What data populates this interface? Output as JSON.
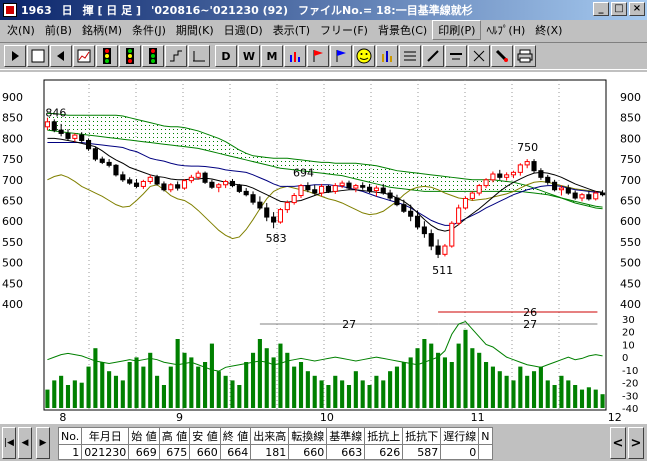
{
  "window": {
    "code": "1963",
    "period": "日",
    "name": "揮 [ 日 足 ]",
    "range": "'020816~'021230 (92)",
    "file": "ファイルNo.= 18:一目基準線就杉"
  },
  "menu": [
    {
      "label": "次(N)"
    },
    {
      "label": "前(B)"
    },
    {
      "label": "銘柄(M)"
    },
    {
      "label": "条件(J)"
    },
    {
      "label": "期間(K)"
    },
    {
      "label": "日週(D)"
    },
    {
      "label": "表示(T)"
    },
    {
      "label": "フリー(F)"
    },
    {
      "label": "背景色(C)"
    },
    {
      "label": "印刷(P)"
    },
    {
      "label": "ﾍﾙﾌﾟ(H)"
    },
    {
      "label": "終(X)"
    }
  ],
  "toolbar": {
    "d": "D",
    "w": "W",
    "m": "M"
  },
  "chart_data": {
    "type": "candlestick",
    "price_axis": {
      "min": 400,
      "max": 900,
      "ticks": [
        900,
        850,
        800,
        750,
        700,
        650,
        600,
        550,
        500,
        450,
        400
      ]
    },
    "osc_axis": {
      "ticks": [
        30,
        20,
        10,
        0,
        -10,
        -20,
        -30,
        -40
      ]
    },
    "month_labels": [
      {
        "label": "8",
        "i": 0
      },
      {
        "label": "9",
        "i": 17
      },
      {
        "label": "10",
        "i": 38
      },
      {
        "label": "11",
        "i": 60
      },
      {
        "label": "12",
        "i": 80
      }
    ],
    "annotations": {
      "high1": "846",
      "low1": "583",
      "mid1": "694",
      "high2": "750",
      "low2": "511",
      "span1": "27",
      "span2": "26",
      "span3": "27"
    },
    "colors": {
      "up": "#ff0000",
      "down": "#000000",
      "base": "#000080",
      "conv": "#000000",
      "lag": "#808000",
      "cloud": "#008000",
      "volume": "#008000",
      "osc": "#008000"
    },
    "ohlc": [
      [
        828,
        850,
        820,
        840
      ],
      [
        840,
        846,
        815,
        820
      ],
      [
        820,
        835,
        805,
        812
      ],
      [
        812,
        822,
        795,
        800
      ],
      [
        800,
        812,
        792,
        808
      ],
      [
        808,
        815,
        790,
        795
      ],
      [
        795,
        800,
        770,
        775
      ],
      [
        775,
        780,
        745,
        750
      ],
      [
        750,
        756,
        738,
        742
      ],
      [
        742,
        750,
        730,
        735
      ],
      [
        735,
        738,
        708,
        712
      ],
      [
        712,
        720,
        695,
        700
      ],
      [
        700,
        706,
        688,
        692
      ],
      [
        692,
        702,
        680,
        684
      ],
      [
        684,
        700,
        678,
        696
      ],
      [
        696,
        712,
        690,
        706
      ],
      [
        706,
        712,
        686,
        690
      ],
      [
        690,
        696,
        672,
        676
      ],
      [
        676,
        692,
        670,
        688
      ],
      [
        688,
        696,
        674,
        680
      ],
      [
        680,
        702,
        676,
        698
      ],
      [
        698,
        712,
        692,
        706
      ],
      [
        706,
        722,
        700,
        716
      ],
      [
        716,
        720,
        690,
        694
      ],
      [
        694,
        700,
        678,
        682
      ],
      [
        682,
        692,
        670,
        688
      ],
      [
        688,
        700,
        680,
        696
      ],
      [
        696,
        702,
        682,
        686
      ],
      [
        686,
        690,
        668,
        672
      ],
      [
        672,
        680,
        660,
        664
      ],
      [
        664,
        672,
        640,
        646
      ],
      [
        646,
        660,
        628,
        632
      ],
      [
        632,
        644,
        600,
        610
      ],
      [
        610,
        622,
        583,
        598
      ],
      [
        598,
        632,
        594,
        628
      ],
      [
        628,
        650,
        620,
        645
      ],
      [
        645,
        668,
        640,
        662
      ],
      [
        662,
        690,
        656,
        686
      ],
      [
        686,
        694,
        670,
        676
      ],
      [
        676,
        688,
        664,
        668
      ],
      [
        668,
        690,
        660,
        684
      ],
      [
        684,
        688,
        668,
        672
      ],
      [
        672,
        692,
        666,
        686
      ],
      [
        686,
        698,
        680,
        692
      ],
      [
        692,
        698,
        676,
        680
      ],
      [
        680,
        690,
        670,
        686
      ],
      [
        686,
        694,
        676,
        682
      ],
      [
        682,
        690,
        668,
        674
      ],
      [
        674,
        686,
        660,
        680
      ],
      [
        680,
        690,
        664,
        668
      ],
      [
        668,
        676,
        650,
        656
      ],
      [
        656,
        664,
        636,
        640
      ],
      [
        640,
        652,
        620,
        624
      ],
      [
        624,
        640,
        600,
        612
      ],
      [
        612,
        626,
        580,
        586
      ],
      [
        586,
        600,
        560,
        570
      ],
      [
        570,
        580,
        530,
        540
      ],
      [
        540,
        556,
        511,
        520
      ],
      [
        520,
        545,
        515,
        540
      ],
      [
        540,
        600,
        536,
        595
      ],
      [
        595,
        640,
        590,
        632
      ],
      [
        632,
        660,
        628,
        655
      ],
      [
        655,
        672,
        650,
        668
      ],
      [
        668,
        690,
        662,
        686
      ],
      [
        686,
        704,
        680,
        700
      ],
      [
        700,
        720,
        694,
        714
      ],
      [
        714,
        724,
        700,
        706
      ],
      [
        706,
        718,
        698,
        712
      ],
      [
        712,
        722,
        704,
        718
      ],
      [
        718,
        740,
        710,
        736
      ],
      [
        736,
        750,
        728,
        744
      ],
      [
        744,
        750,
        716,
        722
      ],
      [
        722,
        728,
        700,
        706
      ],
      [
        706,
        712,
        688,
        694
      ],
      [
        694,
        700,
        672,
        676
      ],
      [
        676,
        686,
        662,
        680
      ],
      [
        680,
        688,
        664,
        668
      ],
      [
        668,
        674,
        652,
        656
      ],
      [
        656,
        668,
        648,
        664
      ],
      [
        664,
        672,
        650,
        654
      ],
      [
        654,
        672,
        650,
        668
      ],
      [
        668,
        675,
        660,
        664
      ]
    ],
    "base_line": [
      790,
      790,
      790,
      790,
      790,
      790,
      788,
      786,
      784,
      782,
      780,
      778,
      772,
      768,
      760,
      752,
      748,
      745,
      740,
      736,
      734,
      733,
      733,
      732,
      730,
      728,
      724,
      722,
      720,
      718,
      712,
      705,
      698,
      690,
      684,
      684,
      684,
      686,
      686,
      688,
      688,
      688,
      686,
      684,
      680,
      676,
      672,
      666,
      660,
      655,
      650,
      645,
      640,
      632,
      622,
      612,
      602,
      595,
      590,
      590,
      598,
      606,
      614,
      622,
      632,
      640,
      648,
      656,
      664,
      670,
      676,
      680,
      684,
      686,
      686,
      684,
      680,
      676,
      674,
      672,
      670,
      670
    ],
    "conversion_line": [
      800,
      800,
      798,
      795,
      792,
      788,
      784,
      780,
      770,
      758,
      748,
      740,
      730,
      724,
      718,
      712,
      708,
      706,
      702,
      700,
      700,
      702,
      702,
      704,
      702,
      698,
      694,
      690,
      688,
      686,
      680,
      672,
      664,
      656,
      648,
      646,
      648,
      650,
      656,
      662,
      668,
      670,
      672,
      674,
      676,
      676,
      674,
      672,
      670,
      668,
      664,
      656,
      648,
      636,
      620,
      604,
      590,
      580,
      576,
      580,
      592,
      606,
      618,
      630,
      644,
      658,
      672,
      684,
      694,
      702,
      710,
      716,
      718,
      716,
      712,
      706,
      698,
      690,
      684,
      678,
      672,
      670
    ],
    "lag_line": [
      700,
      708,
      712,
      706,
      696,
      684,
      676,
      668,
      660,
      650,
      640,
      634,
      636,
      650,
      666,
      684,
      688,
      676,
      662,
      654,
      650,
      640,
      626,
      610,
      594,
      578,
      566,
      558,
      562,
      580,
      604,
      630,
      654,
      672,
      680,
      684,
      680,
      676,
      672,
      666,
      660,
      654,
      650,
      644,
      636,
      628,
      620,
      616,
      618,
      624,
      636,
      648,
      664,
      676,
      682,
      684,
      682,
      676,
      668,
      662,
      656,
      654,
      650,
      652,
      654,
      658,
      662,
      666,
      672,
      680,
      688,
      694,
      696,
      694,
      690,
      686,
      682,
      678,
      676,
      674,
      672,
      670
    ],
    "cloud_a": [
      860,
      860,
      858,
      856,
      856,
      856,
      856,
      856,
      856,
      856,
      856,
      854,
      850,
      846,
      842,
      838,
      834,
      830,
      828,
      828,
      826,
      822,
      818,
      812,
      806,
      800,
      792,
      782,
      772,
      764,
      758,
      756,
      754,
      752,
      752,
      752,
      750,
      748,
      746,
      744,
      742,
      742,
      740,
      740,
      740,
      740,
      738,
      736,
      734,
      730,
      726,
      722,
      720,
      718,
      716,
      714,
      712,
      710,
      708,
      706,
      704,
      702,
      700,
      700,
      700,
      700,
      698,
      696,
      694,
      690,
      686,
      680,
      674,
      668,
      662,
      656,
      650,
      644,
      640,
      636,
      632,
      630
    ],
    "cloud_b": [
      820,
      818,
      816,
      814,
      812,
      810,
      808,
      806,
      804,
      802,
      800,
      798,
      796,
      794,
      792,
      790,
      788,
      786,
      784,
      782,
      780,
      778,
      776,
      772,
      768,
      764,
      760,
      756,
      752,
      748,
      744,
      740,
      736,
      732,
      728,
      726,
      724,
      722,
      720,
      718,
      716,
      714,
      712,
      710,
      706,
      702,
      698,
      694,
      690,
      686,
      682,
      680,
      678,
      676,
      674,
      672,
      672,
      672,
      672,
      672,
      672,
      672,
      672,
      672,
      672,
      672,
      672,
      672,
      672,
      672,
      670,
      668,
      666,
      664,
      660,
      656,
      652,
      648,
      644,
      640,
      636,
      634
    ],
    "volume": [
      8,
      12,
      14,
      10,
      12,
      11,
      18,
      26,
      20,
      16,
      14,
      12,
      20,
      22,
      18,
      24,
      14,
      10,
      18,
      30,
      24,
      22,
      18,
      20,
      28,
      16,
      14,
      12,
      10,
      20,
      24,
      30,
      26,
      22,
      28,
      24,
      18,
      20,
      16,
      14,
      12,
      10,
      14,
      12,
      10,
      16,
      12,
      10,
      14,
      12,
      16,
      18,
      20,
      22,
      26,
      30,
      28,
      24,
      22,
      20,
      28,
      34,
      26,
      24,
      20,
      18,
      16,
      14,
      12,
      18,
      14,
      16,
      18,
      12,
      10,
      14,
      12,
      10,
      8,
      9,
      8,
      6
    ],
    "oscillator": [
      -2,
      0,
      2,
      3,
      2,
      1,
      -1,
      -3,
      -4,
      -5,
      -4,
      -3,
      -2,
      -3,
      -2,
      -1,
      -2,
      -4,
      -5,
      -6,
      -5,
      -4,
      -6,
      -8,
      -10,
      -11,
      -8,
      -7,
      -6,
      -5,
      -4,
      -3,
      -4,
      -6,
      -5,
      -3,
      -2,
      -1,
      -2,
      -3,
      -2,
      -1,
      0,
      -1,
      -2,
      -3,
      -2,
      -1,
      0,
      -1,
      -2,
      -3,
      -4,
      -5,
      -6,
      -4,
      -2,
      0,
      5,
      18,
      26,
      28,
      22,
      16,
      10,
      8,
      4,
      0,
      -2,
      -4,
      -6,
      -7,
      -8,
      -6,
      -4,
      -2,
      0,
      -2,
      -1,
      1,
      2,
      1
    ]
  },
  "grid": {
    "headers": [
      "No.",
      "年月日",
      "始 値",
      "高 値",
      "安 値",
      "終 値",
      "出来高",
      "転換線",
      "基準線",
      "抵抗上",
      "抵抗下",
      "遅行線",
      "N"
    ],
    "row": [
      "1",
      "021230",
      "669",
      "675",
      "660",
      "664",
      "181",
      "660",
      "663",
      "626",
      "587",
      "0",
      ""
    ]
  }
}
